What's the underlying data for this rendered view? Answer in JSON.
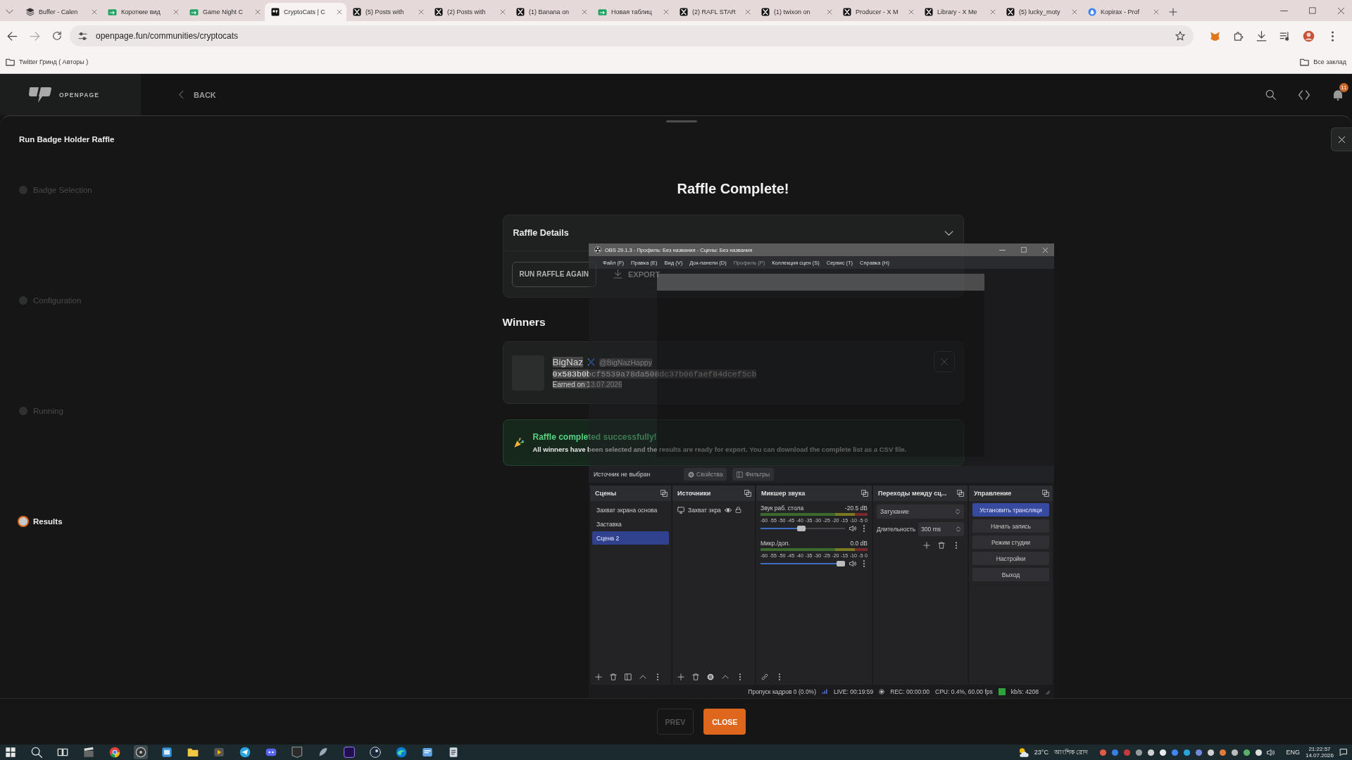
{
  "browser": {
    "tabs": [
      {
        "title": "Buffer - Calen",
        "kind": "buffer",
        "selected": false
      },
      {
        "title": "Короткие вид",
        "kind": "sheets",
        "selected": false
      },
      {
        "title": "Game Night C",
        "kind": "sheets",
        "selected": false
      },
      {
        "title": "CryptoCats | C",
        "kind": "site",
        "selected": true
      },
      {
        "title": "(5) Posts with",
        "kind": "x",
        "selected": false
      },
      {
        "title": "(2) Posts with",
        "kind": "x",
        "selected": false
      },
      {
        "title": "(1) Banana on",
        "kind": "x",
        "selected": false
      },
      {
        "title": "Новая таблиц",
        "kind": "sheets",
        "selected": false
      },
      {
        "title": "(2) RAFL STAR",
        "kind": "x",
        "selected": false
      },
      {
        "title": "(1) twixon on",
        "kind": "x",
        "selected": false
      },
      {
        "title": "Producer - X M",
        "kind": "x",
        "selected": false
      },
      {
        "title": "Library - X Me",
        "kind": "x",
        "selected": false
      },
      {
        "title": "(5) lucky_moty",
        "kind": "x",
        "selected": false
      },
      {
        "title": "Kopirax - Prof",
        "kind": "profile",
        "selected": false
      }
    ],
    "address": "openpage.fun/communities/cryptocats",
    "bookmarks": [
      {
        "label": "Twitter Гринд ( Авторы )"
      }
    ],
    "all_bookmarks": "Все заклад"
  },
  "header": {
    "logo": "OPENPAGE",
    "back": "BACK",
    "notifications": "11"
  },
  "modal": {
    "title": "Run Badge Holder Raffle",
    "steps": [
      {
        "label": "Badge Selection",
        "selected": false
      },
      {
        "label": "Configuration",
        "selected": false
      },
      {
        "label": "Running",
        "selected": false
      },
      {
        "label": "Results",
        "selected": true
      }
    ],
    "heading": "Raffle Complete!",
    "details": {
      "title": "Raffle Details",
      "expanded": true,
      "actions": [
        {
          "label": "RUN RAFFLE AGAIN",
          "kind": "rerun"
        },
        {
          "label": "EXPORT",
          "kind": "export"
        }
      ]
    },
    "winners_title": "Winners",
    "winners": [
      {
        "name": "BigNaz",
        "handle": "@BigNazHappy",
        "address": "0x583b0bcf5539a78da508dc37b06faef84dcef5cb",
        "earned": "Earned on 13.07.2026",
        "highlighted": true
      }
    ],
    "banner": {
      "title": "Raffle completed successfully!",
      "message": "All winners have been selected and the results are ready for export. You can download the complete list as a CSV file."
    },
    "footer": [
      {
        "label": "PREV",
        "kind": "back",
        "disabled": true
      },
      {
        "label": "CLOSE",
        "kind": "close",
        "disabled": false
      }
    ]
  },
  "obs": {
    "title": "OBS 29.1.3 - Профиль: Без названия - Сцены: Без названия",
    "menu": [
      {
        "label": "Файл (F)",
        "disabled": false
      },
      {
        "label": "Правка (E)",
        "disabled": false
      },
      {
        "label": "Вид (V)",
        "disabled": false
      },
      {
        "label": "Док-панели (D)",
        "disabled": false
      },
      {
        "label": "Профиль (P)",
        "disabled": true
      },
      {
        "label": "Коллекция сцен (S)",
        "disabled": false
      },
      {
        "label": "Сервис (T)",
        "disabled": false
      },
      {
        "label": "Справка (H)",
        "disabled": false
      }
    ],
    "source_status": "Источник не выбран",
    "source_buttons": [
      {
        "label": "Свойства",
        "kind": "gear",
        "disabled": true
      },
      {
        "label": "Фильтры",
        "kind": "filter",
        "disabled": true
      }
    ],
    "scenes": {
      "title": "Сцены",
      "items": [
        {
          "label": "Захват экрана основа",
          "selected": false
        },
        {
          "label": "Заставка",
          "selected": false
        },
        {
          "label": "Сцена 2",
          "selected": true
        }
      ]
    },
    "sources": {
      "title": "Источники",
      "items": [
        {
          "label": "Захват экра"
        }
      ]
    },
    "mixer": {
      "title": "Микшер звука",
      "channels": [
        {
          "name": "Звук раб. стола",
          "reading": "-20.5 dB",
          "scale": "-60 -55 -50 -45 -40 -35 -30 -25 -20 -15 -10 -5 0",
          "level": 0.48
        },
        {
          "name": "Микр./доп.",
          "reading": "0.0 dB",
          "scale": "-60 -55 -50 -45 -40 -35 -30 -25 -20 -15 -10 -5 0",
          "level": 1
        }
      ]
    },
    "transitions": {
      "title": "Переходы между сц...",
      "type": "Затухание",
      "duration_label": "Длительность",
      "duration": "300 ms"
    },
    "controls": {
      "title": "Управление",
      "buttons": [
        {
          "label": "Установить трансляци",
          "kind": "primary"
        },
        {
          "label": "Начать запись",
          "kind": "normal"
        },
        {
          "label": "Режим студии",
          "kind": "normal"
        },
        {
          "label": "Настройки",
          "kind": "normal"
        },
        {
          "label": "Выход",
          "kind": "normal"
        }
      ]
    },
    "status": {
      "dropped": "Пропуск кадров 0 (0.0%)",
      "live": "LIVE: 00:19:59",
      "rec": "REC: 00:00:00",
      "cpu": "CPU: 0.4%, 60.00 fps",
      "bitrate": "kb/s: 4208"
    }
  },
  "taskbar": {
    "temperature": "23°C",
    "weather": "আংশিক রোদ",
    "language": "ENG",
    "time": "21:22:57",
    "date": "14.07.2026"
  }
}
